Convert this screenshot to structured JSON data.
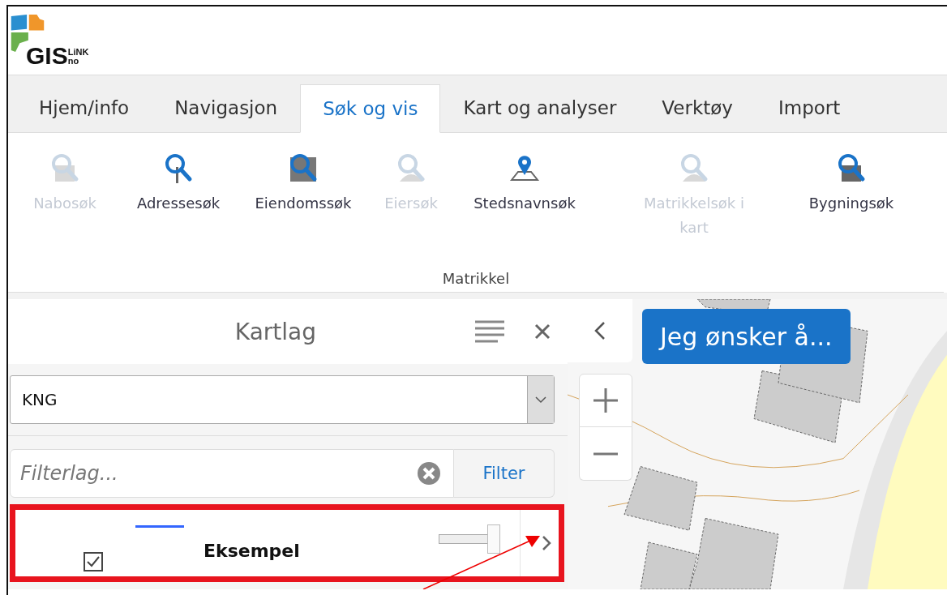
{
  "logo": {
    "text": "GIS",
    "superscript": "LiNK",
    "subscript": "no"
  },
  "tabs": [
    {
      "label": "Hjem/info",
      "selected": false
    },
    {
      "label": "Navigasjon",
      "selected": false
    },
    {
      "label": "Søk og vis",
      "selected": true
    },
    {
      "label": "Kart og analyser",
      "selected": false
    },
    {
      "label": "Verktøy",
      "selected": false
    },
    {
      "label": "Import",
      "selected": false
    }
  ],
  "ribbon": {
    "group_label": "Matrikkel",
    "items": [
      {
        "label": "Nabosøk",
        "kind": "house",
        "disabled": true
      },
      {
        "label": "Adressesøk",
        "kind": "sign",
        "disabled": false
      },
      {
        "label": "Eiendomssøk",
        "kind": "fence",
        "disabled": false
      },
      {
        "label": "Eiersøk",
        "kind": "person",
        "disabled": true
      },
      {
        "label": "Stedsnavnsøk",
        "kind": "pin",
        "disabled": false
      },
      {
        "label": "Matrikkelsøk i kart",
        "kind": "map",
        "disabled": true
      },
      {
        "label": "Bygningsøk",
        "kind": "building",
        "disabled": false
      }
    ]
  },
  "layer_panel": {
    "title": "Kartlag",
    "select_value": "KNG",
    "filter": {
      "placeholder": "Filterlag...",
      "button": "Filter"
    },
    "layers": [
      {
        "name": "Eksempel",
        "checked": true,
        "color": "#3366ff",
        "level": 1,
        "highlighted": true
      }
    ]
  },
  "map": {
    "kind": "picture",
    "action_button": "Jeg ønsker å..."
  }
}
